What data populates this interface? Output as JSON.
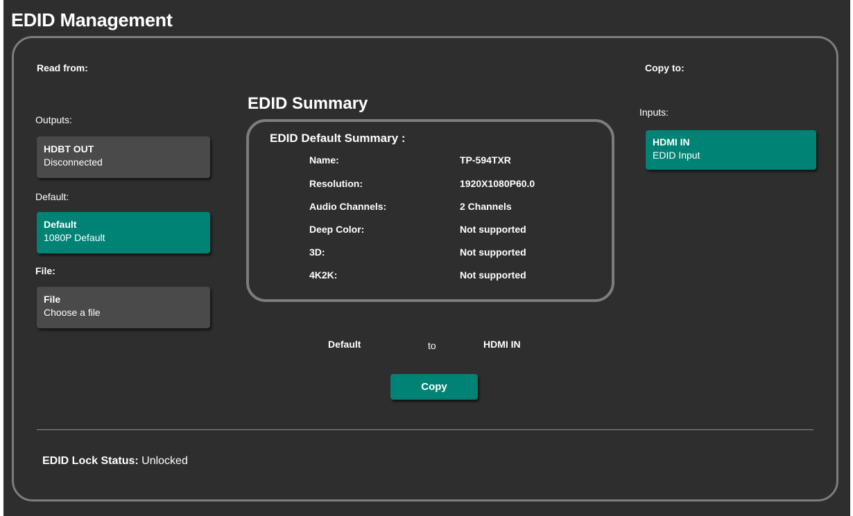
{
  "title": "EDID Management",
  "read_from": {
    "label": "Read from:",
    "outputs_label": "Outputs:",
    "outputs_tile": {
      "name": "HDBT OUT",
      "status": "Disconnected"
    },
    "default_label": "Default:",
    "default_tile": {
      "name": "Default",
      "status": "1080P Default"
    },
    "file_label": "File:",
    "file_tile": {
      "name": "File",
      "status": "Choose a file"
    }
  },
  "summary": {
    "title": "EDID Summary",
    "subtitle": "EDID Default Summary :",
    "rows": [
      {
        "key": "Name:",
        "value": "TP-594TXR"
      },
      {
        "key": "Resolution:",
        "value": "1920X1080P60.0"
      },
      {
        "key": "Audio Channels:",
        "value": "2 Channels"
      },
      {
        "key": "Deep Color:",
        "value": "Not supported"
      },
      {
        "key": "3D:",
        "value": "Not supported"
      },
      {
        "key": "4K2K:",
        "value": "Not supported"
      }
    ]
  },
  "copy_to": {
    "label": "Copy to:",
    "inputs_label": "Inputs:",
    "input_tile": {
      "name": "HDMI IN",
      "status": "EDID Input"
    }
  },
  "flow": {
    "source": "Default",
    "connector": "to",
    "target": "HDMI IN"
  },
  "copy_button": "Copy",
  "lock": {
    "label": "EDID Lock Status:",
    "value": "Unlocked"
  },
  "colors": {
    "background": "#2e2e2e",
    "accent": "#008375",
    "tile": "#4a4a4a",
    "border": "#7d7d7d"
  }
}
